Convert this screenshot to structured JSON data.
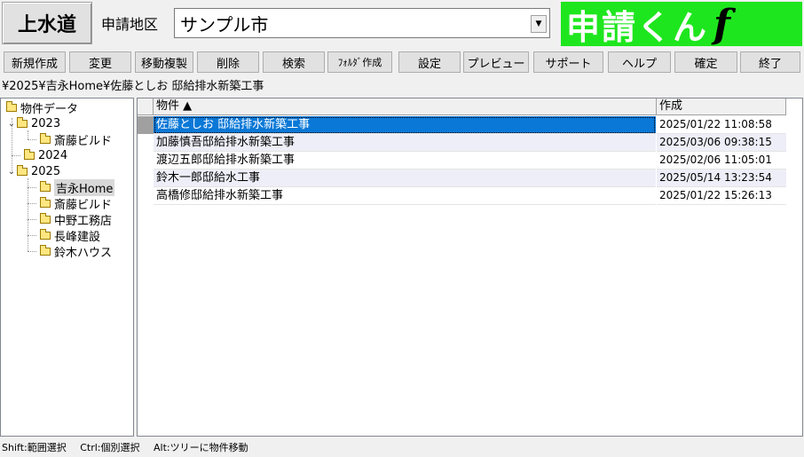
{
  "header": {
    "mode_label": "上水道",
    "region_label": "申請地区",
    "region_value": "サンプル市",
    "logo_text": "申請くん",
    "logo_mark": "f"
  },
  "toolbar": {
    "buttons": [
      "新規作成",
      "変更",
      "移動複製",
      "削除",
      "検索",
      "ﾌｫﾙﾀﾞ作成",
      "設定",
      "プレビュー",
      "サポート",
      "ヘルプ",
      "確定",
      "終了"
    ]
  },
  "path": "¥2025¥吉永Home¥佐藤としお 邸給排水新築工事",
  "tree": {
    "root": "物件データ",
    "nodes": [
      "2023",
      "斎藤ビルド",
      "2024",
      "2025",
      "吉永Home",
      "斎藤ビルド",
      "中野工務店",
      "長峰建設",
      "鈴木ハウス"
    ]
  },
  "list": {
    "headers": [
      "物件 ▲",
      "作成"
    ],
    "rows": [
      {
        "name": "佐藤としお 邸給排水新築工事",
        "date": "2025/01/22 11:08:58"
      },
      {
        "name": "加藤慎吾邸給排水新築工事",
        "date": "2025/03/06 09:38:15"
      },
      {
        "name": "渡辺五郎邸給排水新築工事",
        "date": "2025/02/06 11:05:01"
      },
      {
        "name": "鈴木一郎邸給水工事",
        "date": "2025/05/14 13:23:54"
      },
      {
        "name": "高橋修邸給排水新築工事",
        "date": "2025/01/22 15:26:13"
      }
    ]
  },
  "status": {
    "items": [
      "Shift:範囲選択",
      "Ctrl:個別選択",
      "Alt:ツリーに物件移動"
    ]
  },
  "colors": {
    "logo_bg": "#1ee61e",
    "selection": "#0a78d7",
    "alt_row": "#eeeef8"
  }
}
